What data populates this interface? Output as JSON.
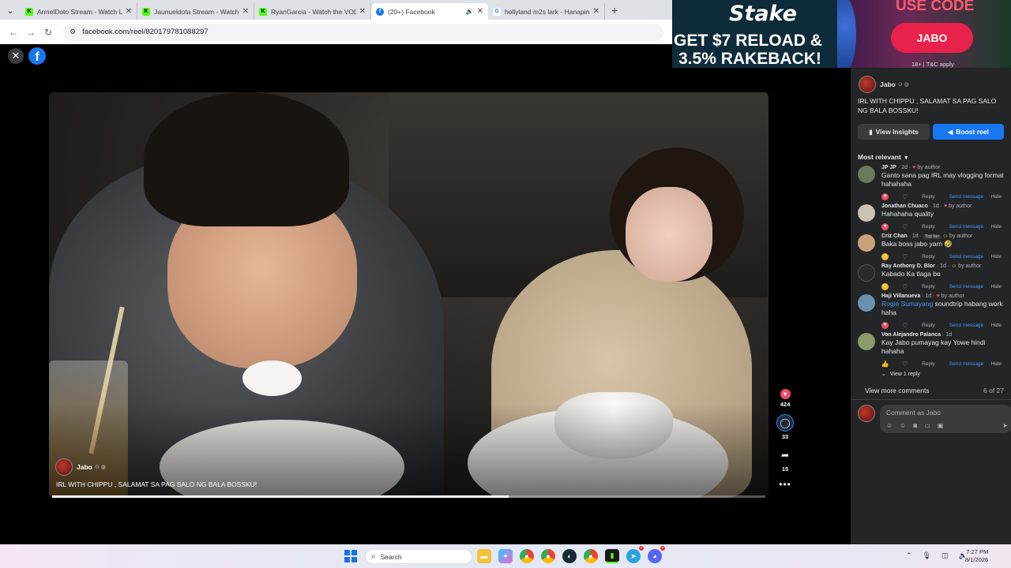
{
  "browser": {
    "tabs": [
      {
        "title": "ArmelDoto Stream - Watch Live...",
        "fav": "K",
        "favcolor": "#53fc18"
      },
      {
        "title": "Jaunueldota Stream - Watch Liv...",
        "fav": "K",
        "favcolor": "#53fc18"
      },
      {
        "title": "RyanGarcia - Watch the VOD o...",
        "fav": "K",
        "favcolor": "#53fc18"
      },
      {
        "title": "(20+) Facebook",
        "fav": "f",
        "favcolor": "#1877f2"
      },
      {
        "title": "hollyland m2s lark - Hanapin sa...",
        "fav": "G",
        "favcolor": "#ffffff"
      }
    ],
    "url": "facebook.com/reel/820179781088297"
  },
  "ad": {
    "brand": "Stake",
    "line1": "GET $7 RELOAD &",
    "line2": "3.5% RAKEBACK!",
    "use_code": "USE CODE",
    "code": "JABO",
    "terms": "18+ | T&C apply"
  },
  "video": {
    "author": "Jabo",
    "caption": "IRL WITH CHIPPU , SALAMAT SA PAG SALO NG BALA BOSSKU!",
    "progress": 0.64
  },
  "actions": {
    "likes": "424",
    "comments": "33",
    "shares": "15"
  },
  "panel": {
    "author": "Jabo",
    "title": "IRL WITH CHIPPU , SALAMAT SA PAG SALO NG BALA BOSSKU!",
    "insights_label": "View Insights",
    "boost_label": "Boost reel",
    "sort_label": "Most relevant",
    "comments": [
      {
        "name": "JP JP",
        "time": "2d",
        "badge": "by author",
        "top": "",
        "text": "Ganto sana pag IRL may vlogging format hahahaha",
        "mention": "",
        "react": "heart",
        "avcolor": "#6a7a5a"
      },
      {
        "name": "Jonathan Chuaco",
        "time": "1d",
        "badge": "by author",
        "top": "",
        "text": "Hahahaha quality",
        "mention": "",
        "react": "heart",
        "avcolor": "#c9c2b5"
      },
      {
        "name": "Criz Chan",
        "time": "1d",
        "badge": "by author",
        "top": "Top fan",
        "text": "Baka boss jabo yarn 🤣",
        "mention": "",
        "react": "laugh",
        "avcolor": "#c9a27a"
      },
      {
        "name": "Ray Anthony D. Blor",
        "time": "1d",
        "badge": "by author",
        "top": "",
        "text": "Kabado Ka tlaga bo",
        "mention": "",
        "react": "laugh",
        "avcolor": "#2a2a2a"
      },
      {
        "name": "Haji Villanueva",
        "time": "1d",
        "badge": "by author",
        "top": "",
        "text": "soundtrip habang work haha",
        "mention": "Rogie Sumayang",
        "react": "heart",
        "avcolor": "#6b8fb0"
      },
      {
        "name": "Von Alejandro Palanca",
        "time": "1d",
        "badge": "",
        "top": "",
        "text": "Kay Jabo pumayag kay Yowe hindi hahaha",
        "mention": "",
        "react": "like",
        "avcolor": "#8a9a6a"
      }
    ],
    "reply_label": "Reply",
    "send_label": "Send message",
    "hide_label": "Hide",
    "view_replies": "View 1 reply",
    "view_more": "View more comments",
    "count": "6 of 27",
    "comment_placeholder": "Comment as Jabo"
  },
  "taskbar": {
    "search": "Search",
    "time": "7:27 PM",
    "date": "8/1/2026"
  }
}
